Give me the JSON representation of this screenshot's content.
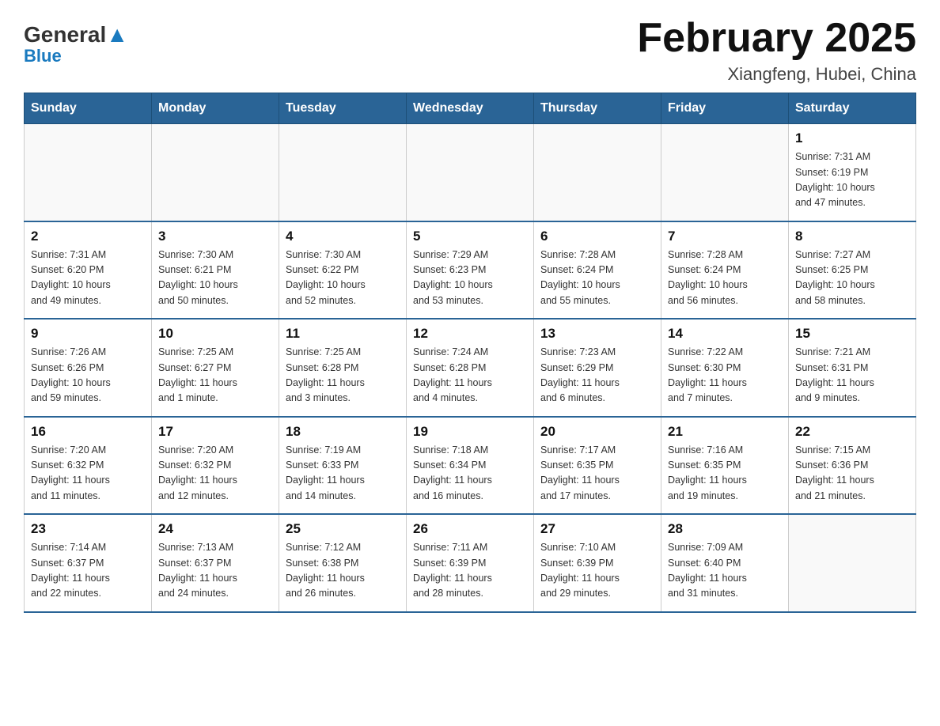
{
  "header": {
    "logo_general": "General",
    "logo_blue": "Blue",
    "month_title": "February 2025",
    "location": "Xiangfeng, Hubei, China"
  },
  "weekdays": [
    "Sunday",
    "Monday",
    "Tuesday",
    "Wednesday",
    "Thursday",
    "Friday",
    "Saturday"
  ],
  "weeks": [
    [
      {
        "day": "",
        "info": ""
      },
      {
        "day": "",
        "info": ""
      },
      {
        "day": "",
        "info": ""
      },
      {
        "day": "",
        "info": ""
      },
      {
        "day": "",
        "info": ""
      },
      {
        "day": "",
        "info": ""
      },
      {
        "day": "1",
        "info": "Sunrise: 7:31 AM\nSunset: 6:19 PM\nDaylight: 10 hours\nand 47 minutes."
      }
    ],
    [
      {
        "day": "2",
        "info": "Sunrise: 7:31 AM\nSunset: 6:20 PM\nDaylight: 10 hours\nand 49 minutes."
      },
      {
        "day": "3",
        "info": "Sunrise: 7:30 AM\nSunset: 6:21 PM\nDaylight: 10 hours\nand 50 minutes."
      },
      {
        "day": "4",
        "info": "Sunrise: 7:30 AM\nSunset: 6:22 PM\nDaylight: 10 hours\nand 52 minutes."
      },
      {
        "day": "5",
        "info": "Sunrise: 7:29 AM\nSunset: 6:23 PM\nDaylight: 10 hours\nand 53 minutes."
      },
      {
        "day": "6",
        "info": "Sunrise: 7:28 AM\nSunset: 6:24 PM\nDaylight: 10 hours\nand 55 minutes."
      },
      {
        "day": "7",
        "info": "Sunrise: 7:28 AM\nSunset: 6:24 PM\nDaylight: 10 hours\nand 56 minutes."
      },
      {
        "day": "8",
        "info": "Sunrise: 7:27 AM\nSunset: 6:25 PM\nDaylight: 10 hours\nand 58 minutes."
      }
    ],
    [
      {
        "day": "9",
        "info": "Sunrise: 7:26 AM\nSunset: 6:26 PM\nDaylight: 10 hours\nand 59 minutes."
      },
      {
        "day": "10",
        "info": "Sunrise: 7:25 AM\nSunset: 6:27 PM\nDaylight: 11 hours\nand 1 minute."
      },
      {
        "day": "11",
        "info": "Sunrise: 7:25 AM\nSunset: 6:28 PM\nDaylight: 11 hours\nand 3 minutes."
      },
      {
        "day": "12",
        "info": "Sunrise: 7:24 AM\nSunset: 6:28 PM\nDaylight: 11 hours\nand 4 minutes."
      },
      {
        "day": "13",
        "info": "Sunrise: 7:23 AM\nSunset: 6:29 PM\nDaylight: 11 hours\nand 6 minutes."
      },
      {
        "day": "14",
        "info": "Sunrise: 7:22 AM\nSunset: 6:30 PM\nDaylight: 11 hours\nand 7 minutes."
      },
      {
        "day": "15",
        "info": "Sunrise: 7:21 AM\nSunset: 6:31 PM\nDaylight: 11 hours\nand 9 minutes."
      }
    ],
    [
      {
        "day": "16",
        "info": "Sunrise: 7:20 AM\nSunset: 6:32 PM\nDaylight: 11 hours\nand 11 minutes."
      },
      {
        "day": "17",
        "info": "Sunrise: 7:20 AM\nSunset: 6:32 PM\nDaylight: 11 hours\nand 12 minutes."
      },
      {
        "day": "18",
        "info": "Sunrise: 7:19 AM\nSunset: 6:33 PM\nDaylight: 11 hours\nand 14 minutes."
      },
      {
        "day": "19",
        "info": "Sunrise: 7:18 AM\nSunset: 6:34 PM\nDaylight: 11 hours\nand 16 minutes."
      },
      {
        "day": "20",
        "info": "Sunrise: 7:17 AM\nSunset: 6:35 PM\nDaylight: 11 hours\nand 17 minutes."
      },
      {
        "day": "21",
        "info": "Sunrise: 7:16 AM\nSunset: 6:35 PM\nDaylight: 11 hours\nand 19 minutes."
      },
      {
        "day": "22",
        "info": "Sunrise: 7:15 AM\nSunset: 6:36 PM\nDaylight: 11 hours\nand 21 minutes."
      }
    ],
    [
      {
        "day": "23",
        "info": "Sunrise: 7:14 AM\nSunset: 6:37 PM\nDaylight: 11 hours\nand 22 minutes."
      },
      {
        "day": "24",
        "info": "Sunrise: 7:13 AM\nSunset: 6:37 PM\nDaylight: 11 hours\nand 24 minutes."
      },
      {
        "day": "25",
        "info": "Sunrise: 7:12 AM\nSunset: 6:38 PM\nDaylight: 11 hours\nand 26 minutes."
      },
      {
        "day": "26",
        "info": "Sunrise: 7:11 AM\nSunset: 6:39 PM\nDaylight: 11 hours\nand 28 minutes."
      },
      {
        "day": "27",
        "info": "Sunrise: 7:10 AM\nSunset: 6:39 PM\nDaylight: 11 hours\nand 29 minutes."
      },
      {
        "day": "28",
        "info": "Sunrise: 7:09 AM\nSunset: 6:40 PM\nDaylight: 11 hours\nand 31 minutes."
      },
      {
        "day": "",
        "info": ""
      }
    ]
  ]
}
